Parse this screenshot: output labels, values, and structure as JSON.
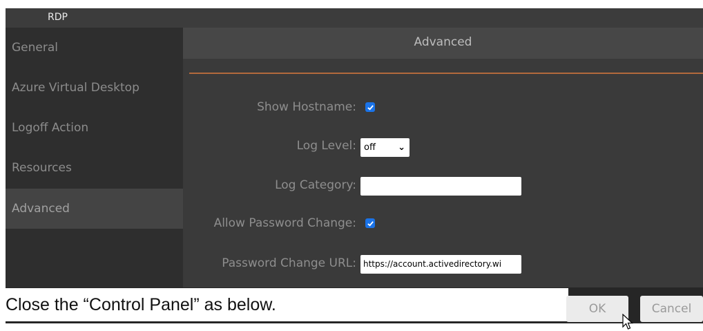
{
  "window": {
    "title": "RDP"
  },
  "sidebar": {
    "items": [
      {
        "label": "General"
      },
      {
        "label": "Azure Virtual Desktop"
      },
      {
        "label": "Logoff Action"
      },
      {
        "label": "Resources"
      },
      {
        "label": "Advanced"
      }
    ]
  },
  "main": {
    "header": "Advanced",
    "fields": {
      "show_hostname": {
        "label": "Show Hostname:",
        "checked": true
      },
      "log_level": {
        "label": "Log Level:",
        "value": "off"
      },
      "log_category": {
        "label": "Log Category:",
        "value": ""
      },
      "allow_password_change": {
        "label": "Allow Password Change:",
        "checked": true
      },
      "password_change_url": {
        "label": "Password Change URL:",
        "value": "https://account.activedirectory.wi"
      }
    }
  },
  "caption": "Close the “Control Panel” as below.",
  "buttons": {
    "ok": "OK",
    "cancel": "Cancel"
  },
  "colors": {
    "accent": "#b36a3c",
    "checkbox": "#1a73e8"
  }
}
